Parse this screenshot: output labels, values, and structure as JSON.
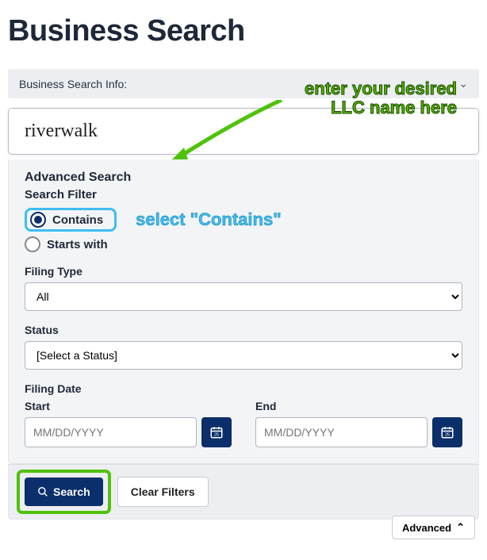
{
  "page": {
    "title": "Business Search"
  },
  "annotations": {
    "enter_name": "enter your desired\nLLC name here",
    "select_contains": "select \"Contains\""
  },
  "info_bar": {
    "label": "Business Search Info:"
  },
  "search": {
    "value": "riverwalk"
  },
  "advanced": {
    "title": "Advanced Search",
    "filter_label": "Search Filter",
    "radios": {
      "contains": "Contains",
      "starts": "Starts with"
    },
    "filing_type": {
      "label": "Filing Type",
      "selected": "All"
    },
    "status": {
      "label": "Status",
      "selected": "[Select a Status]"
    },
    "filing_date": {
      "label": "Filing Date",
      "start_label": "Start",
      "end_label": "End",
      "placeholder": "MM/DD/YYYY"
    }
  },
  "actions": {
    "search": "Search",
    "clear": "Clear Filters",
    "advanced": "Advanced"
  }
}
